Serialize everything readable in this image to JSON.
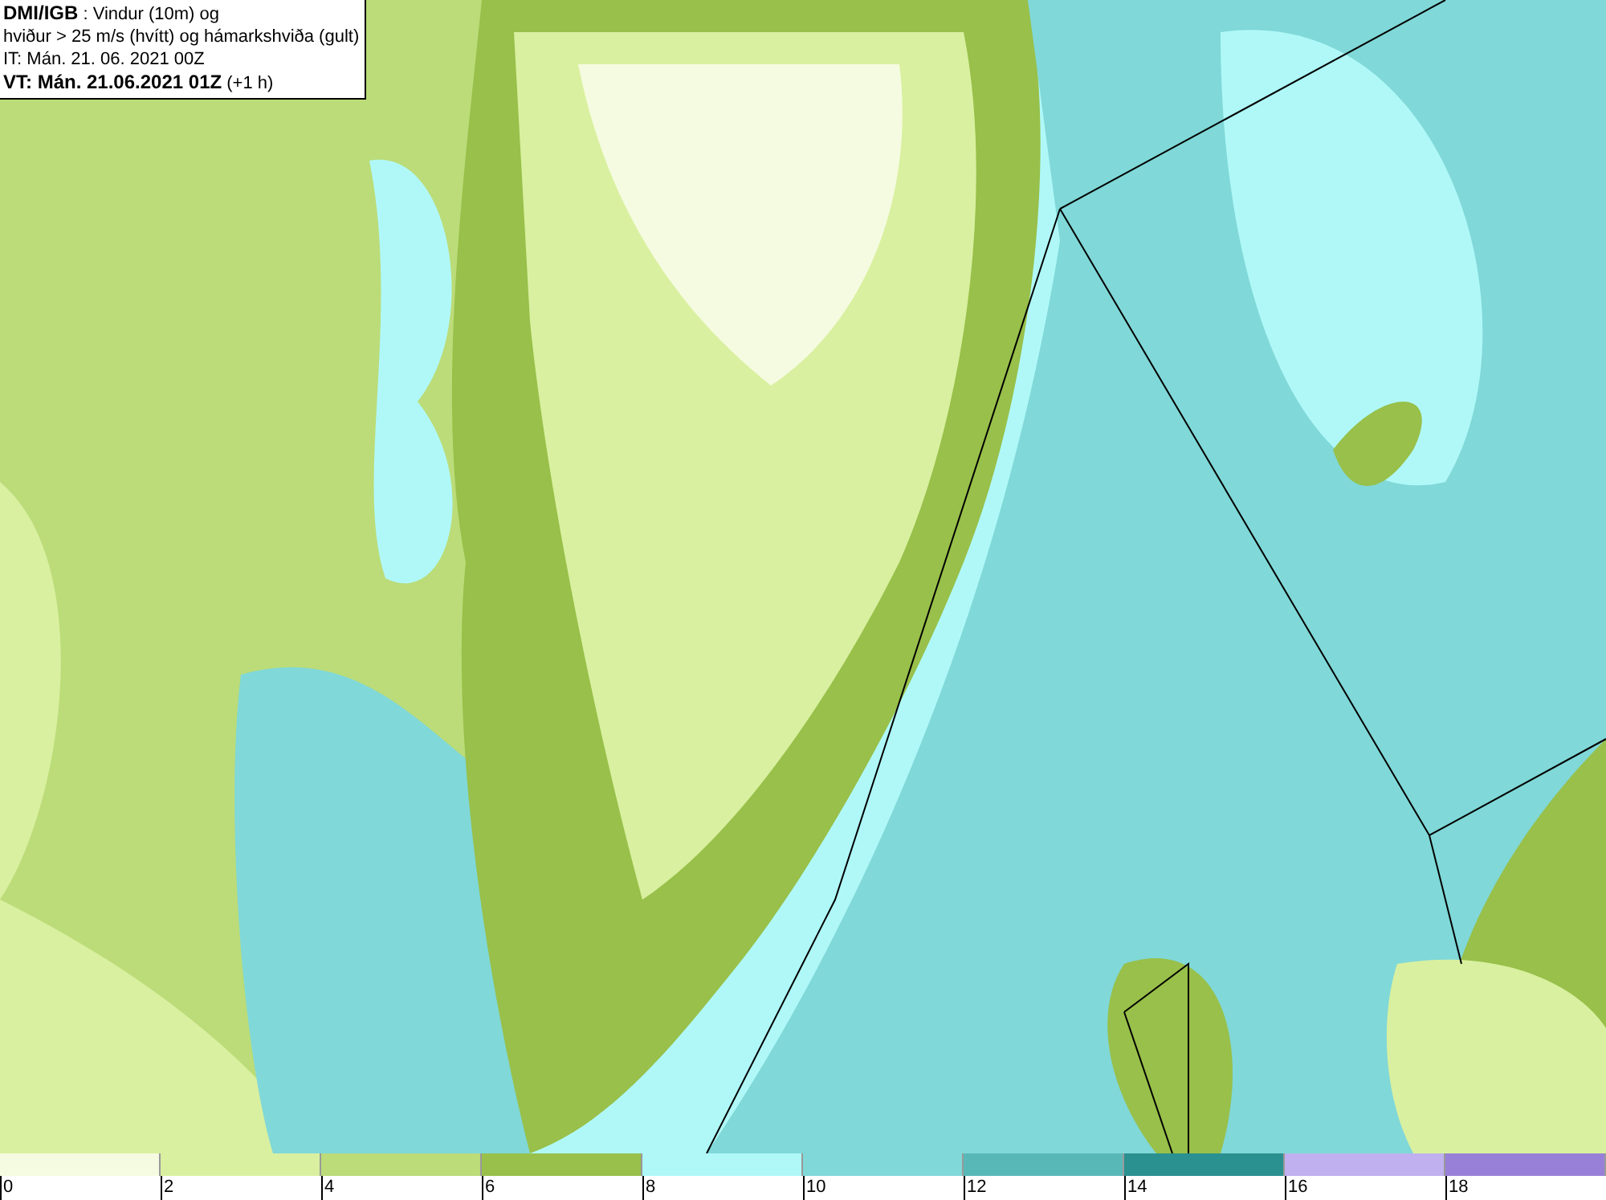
{
  "header": {
    "source": "DMI/IGB",
    "title_rest": " : Vindur (10m) og",
    "line_2": "hviður > 25 m/s (hvítt) og hámarkshviða (gult)",
    "initial_time": "IT: Mán. 21. 06. 2021 00Z",
    "valid_time": "VT: Mán. 21.06.2021 01Z",
    "offset": " (+1 h)"
  },
  "legend": [
    {
      "label": "0",
      "color": "#f5fbe0"
    },
    {
      "label": "2",
      "color": "#d9f0a0"
    },
    {
      "label": "4",
      "color": "#bbdc78"
    },
    {
      "label": "6",
      "color": "#98c04a"
    },
    {
      "label": "8",
      "color": "#b0f8f8"
    },
    {
      "label": "10",
      "color": "#80d8d8"
    },
    {
      "label": "12",
      "color": "#58b8b8"
    },
    {
      "label": "14",
      "color": "#2a9090"
    },
    {
      "label": "16",
      "color": "#c0b0f0"
    },
    {
      "label": "18",
      "color": "#9880d8"
    }
  ]
}
